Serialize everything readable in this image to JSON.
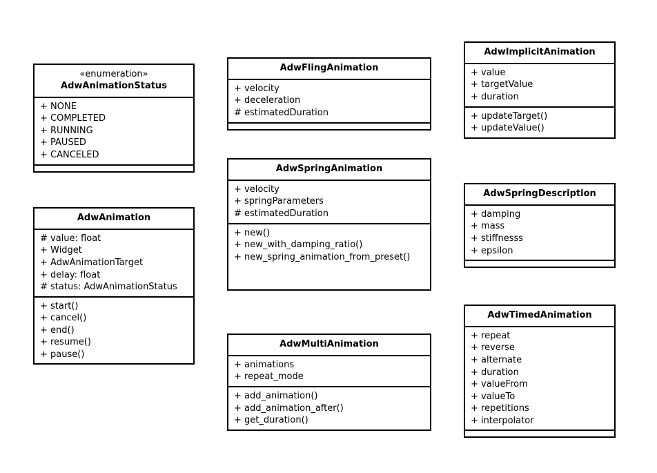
{
  "classes": {
    "status": {
      "stereotype": "«enumeration»",
      "name": "AdwAnimationStatus",
      "attrs": [
        "+ NONE",
        "+ COMPLETED",
        "+ RUNNING",
        "+ PAUSED",
        "+ CANCELED"
      ],
      "ops": []
    },
    "animation": {
      "name": "AdwAnimation",
      "attrs": [
        "# value: float",
        "+ Widget",
        "+ AdwAnimationTarget",
        "+ delay: float",
        "# status: AdwAnimationStatus"
      ],
      "ops": [
        "+ start()",
        "+ cancel()",
        "+ end()",
        "+ resume()",
        "+ pause()"
      ]
    },
    "fling": {
      "name": "AdwFlingAnimation",
      "attrs": [
        "+ velocity",
        "+ deceleration",
        "# estimatedDuration"
      ],
      "ops": []
    },
    "spring": {
      "name": "AdwSpringAnimation",
      "attrs": [
        "+ velocity",
        "+ springParameters",
        "# estimatedDuration"
      ],
      "ops": [
        "+ new()",
        "+ new_with_damping_ratio()",
        "+ new_spring_animation_from_preset()"
      ]
    },
    "multi": {
      "name": "AdwMultiAnimation",
      "attrs": [
        "+ animations",
        "+ repeat_mode"
      ],
      "ops": [
        "+ add_animation()",
        "+ add_animation_after()",
        "+ get_duration()"
      ]
    },
    "implicit": {
      "name": "AdwImplicitAnimation",
      "attrs": [
        "+ value",
        "+ targetValue",
        "+ duration"
      ],
      "ops": [
        "+ updateTarget()",
        "+ updateValue()"
      ]
    },
    "springdesc": {
      "name": "AdwSpringDescription",
      "attrs": [
        "+ damping",
        "+ mass",
        "+ stiffnesss",
        "+ epsilon"
      ],
      "ops": []
    },
    "timed": {
      "name": "AdwTimedAnimation",
      "attrs": [
        "+ repeat",
        "+ reverse",
        "+ alternate",
        "+ duration",
        "+ valueFrom",
        "+ valueTo",
        "+ repetitions",
        "+ interpolator"
      ],
      "ops": []
    }
  },
  "chart_data": [
    {
      "type": "table",
      "title": "UML class diagram — Adw animation classes",
      "classes": [
        {
          "name": "AdwAnimationStatus",
          "stereotype": "enumeration",
          "attributes": [
            "NONE",
            "COMPLETED",
            "RUNNING",
            "PAUSED",
            "CANCELED"
          ],
          "operations": []
        },
        {
          "name": "AdwAnimation",
          "attributes": [
            "value: float (protected)",
            "Widget",
            "AdwAnimationTarget",
            "delay: float",
            "status: AdwAnimationStatus (protected)"
          ],
          "operations": [
            "start()",
            "cancel()",
            "end()",
            "resume()",
            "pause()"
          ]
        },
        {
          "name": "AdwFlingAnimation",
          "attributes": [
            "velocity",
            "deceleration",
            "estimatedDuration (protected)"
          ],
          "operations": []
        },
        {
          "name": "AdwSpringAnimation",
          "attributes": [
            "velocity",
            "springParameters",
            "estimatedDuration (protected)"
          ],
          "operations": [
            "new()",
            "new_with_damping_ratio()",
            "new_spring_animation_from_preset()"
          ]
        },
        {
          "name": "AdwMultiAnimation",
          "attributes": [
            "animations",
            "repeat_mode"
          ],
          "operations": [
            "add_animation()",
            "add_animation_after()",
            "get_duration()"
          ]
        },
        {
          "name": "AdwImplicitAnimation",
          "attributes": [
            "value",
            "targetValue",
            "duration"
          ],
          "operations": [
            "updateTarget()",
            "updateValue()"
          ]
        },
        {
          "name": "AdwSpringDescription",
          "attributes": [
            "damping",
            "mass",
            "stiffnesss",
            "epsilon"
          ],
          "operations": []
        },
        {
          "name": "AdwTimedAnimation",
          "attributes": [
            "repeat",
            "reverse",
            "alternate",
            "duration",
            "valueFrom",
            "valueTo",
            "repetitions",
            "interpolator"
          ],
          "operations": []
        }
      ]
    }
  ]
}
